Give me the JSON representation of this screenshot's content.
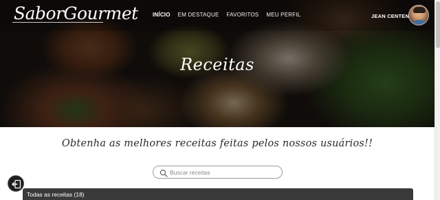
{
  "brand": {
    "logo": "SaborGourmet"
  },
  "nav": {
    "items": [
      {
        "label": "INÍCIO",
        "active": true
      },
      {
        "label": "EM DESTAQUE",
        "active": false
      },
      {
        "label": "FAVORITOS",
        "active": false
      },
      {
        "label": "MEU PERFIL",
        "active": false
      }
    ],
    "user_name": "JEAN CENTENO"
  },
  "hero": {
    "title": "Receitas"
  },
  "main": {
    "tagline": "Obtenha as melhores receitas feitas pelos nossos usuários!!",
    "search": {
      "placeholder": "Buscar receitas",
      "value": ""
    },
    "list_header": "Todas as receitas (18)"
  },
  "colors": {
    "overlay": "#000000",
    "list_header_bg": "#3a3a3a",
    "text_dark": "#2a2a2a"
  },
  "icons": {
    "search": "search-icon",
    "back": "logout-icon",
    "avatar": "avatar"
  }
}
